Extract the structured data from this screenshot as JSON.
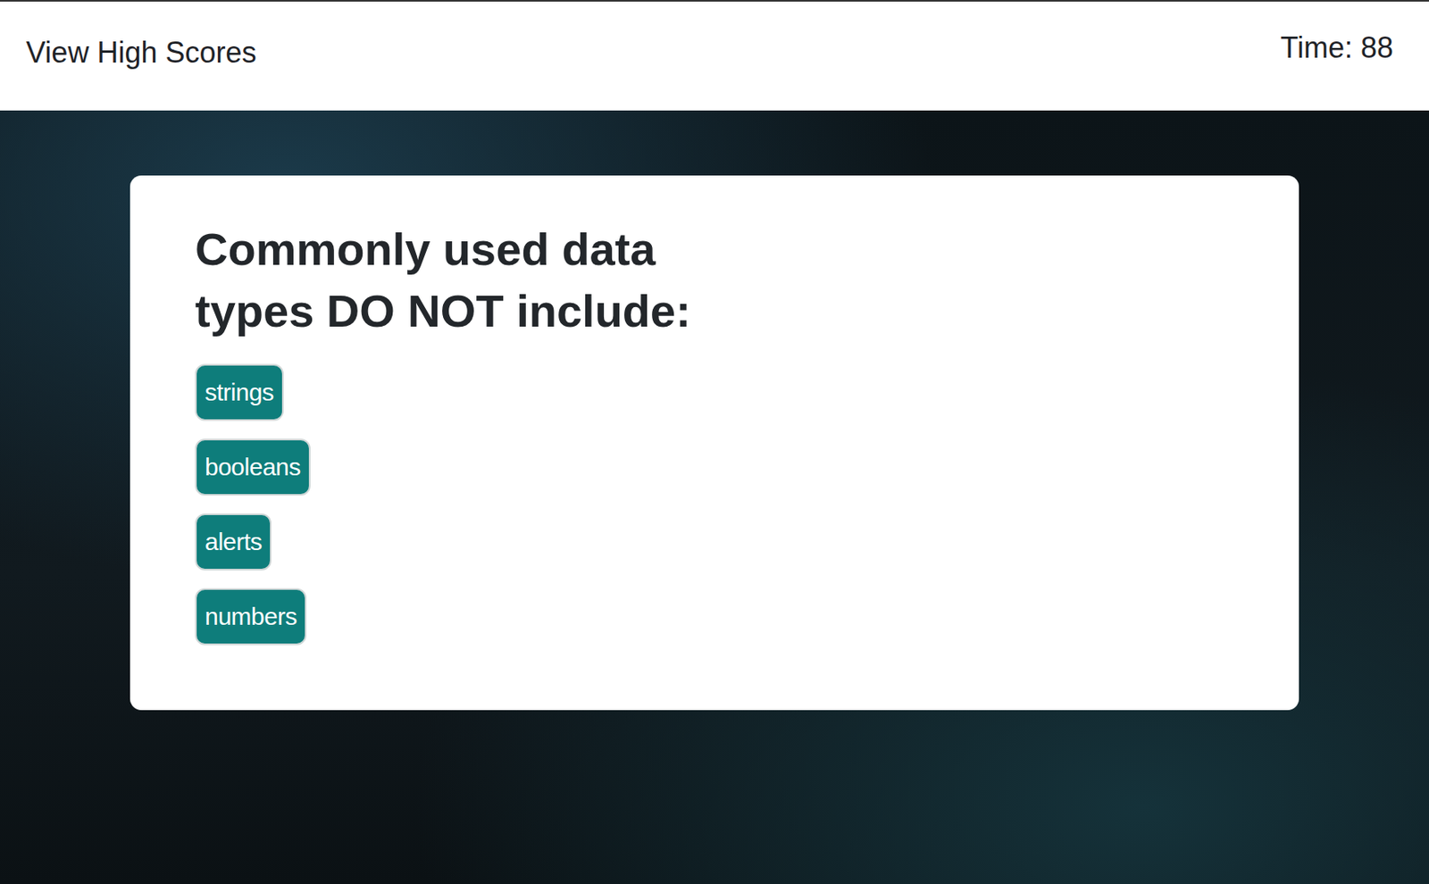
{
  "header": {
    "link": "View High Scores",
    "timer": "Time: 88"
  },
  "quiz": {
    "question": "Commonly used data types DO NOT include:",
    "choices": [
      "strings",
      "booleans",
      "alerts",
      "numbers"
    ]
  }
}
